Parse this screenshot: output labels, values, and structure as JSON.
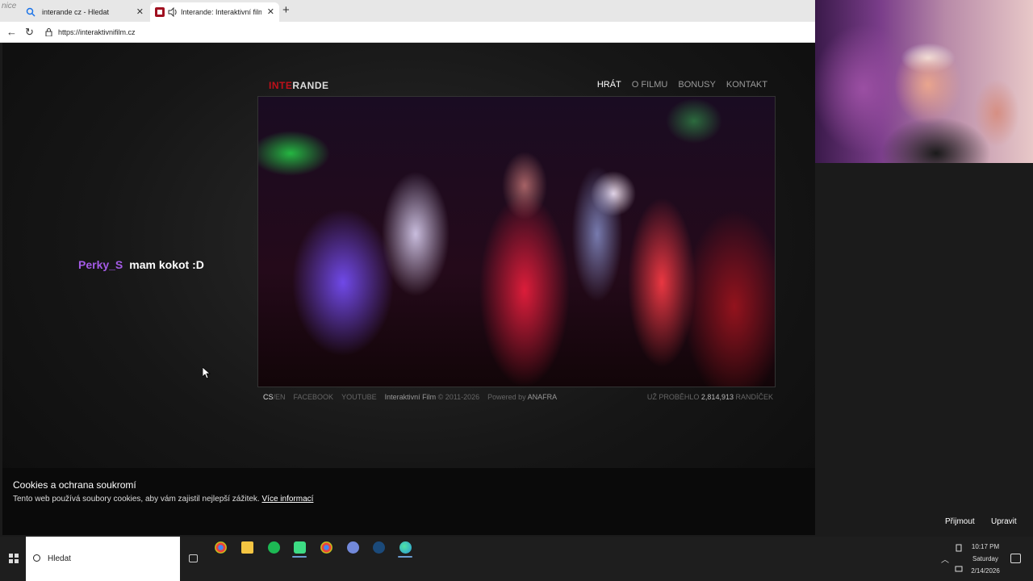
{
  "browser": {
    "corner_logo": "nice",
    "tabs": [
      {
        "title": "interande cz - Hledat",
        "active": false
      },
      {
        "title": "Interande: Interaktivní film, co",
        "active": true
      }
    ],
    "new_tab": "+",
    "url": "https://interaktivnifilm.cz"
  },
  "site": {
    "logo_red": "INTE",
    "logo_white": "RANDE",
    "menu": [
      "HRÁT",
      "O FILMU",
      "BONUSY",
      "KONTAKT"
    ],
    "active_menu": "HRÁT",
    "footer": {
      "lang_cs": "CS",
      "lang_sep": "/",
      "lang_en": "EN",
      "facebook": "FACEBOOK",
      "youtube": "YOUTUBE",
      "brand": "Interaktivní Film",
      "copyright": "© 2011-2026",
      "powered_by": "Powered by",
      "powered_brand": "ANAFRA",
      "dates_prefix": "UŽ PROBĚHLO",
      "dates_count": "2,814,913",
      "dates_suffix": "RANDÍČEK"
    }
  },
  "chat": {
    "user": "Perky_S",
    "message": "mam kokot :D"
  },
  "cookie": {
    "title": "Cookies a ochrana soukromí",
    "text": "Tento web používá soubory cookies, aby vám zajistil nejlepší zážitek.",
    "link": "Více informací",
    "accept": "Přijmout",
    "edit": "Upravit"
  },
  "taskbar": {
    "search_placeholder": "Hledat",
    "apps": [
      {
        "name": "chrome-icon",
        "color": "#e8453c"
      },
      {
        "name": "file-explorer-icon",
        "color": "#f4c542"
      },
      {
        "name": "spotify-icon",
        "color": "#1db954"
      },
      {
        "name": "android-studio-icon",
        "color": "#3ddc84"
      },
      {
        "name": "chrome-alt-icon",
        "color": "#e8453c"
      },
      {
        "name": "discord-icon",
        "color": "#7289da"
      },
      {
        "name": "steam-icon",
        "color": "#1b4a7a"
      },
      {
        "name": "edge-icon",
        "color": "#2a9bd6"
      }
    ],
    "time": "10:17 PM",
    "day": "Saturday",
    "date": "2/14/2026"
  }
}
